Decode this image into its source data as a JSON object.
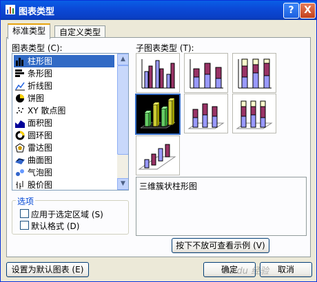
{
  "window": {
    "title": "图表类型"
  },
  "title_buttons": {
    "help": "?",
    "close": "X"
  },
  "tabs": [
    "标准类型",
    "自定义类型"
  ],
  "chart_type_label": "图表类型 (C):",
  "chart_types": [
    "柱形图",
    "条形图",
    "折线图",
    "饼图",
    "XY 散点图",
    "面积图",
    "圆环图",
    "雷达图",
    "曲面图",
    "气泡图",
    "股价图"
  ],
  "selected_chart_type": "柱形图",
  "subtype_label": "子图表类型 (T):",
  "options": {
    "group_label": "选项",
    "apply_to_selection": "应用于选定区域 (S)",
    "default_format": "默认格式 (D)"
  },
  "subtype_description": "三维簇状柱形图",
  "preview_button": "按下不放可查看示例 (V)",
  "set_default_button": "设置为默认图表 (E)",
  "ok_button": "确定",
  "cancel_button": "取消",
  "colors": {
    "accent_tab": "#e6a20c",
    "selection": "#316ac5",
    "bar_purple": "#9999ff",
    "bar_maroon": "#993366",
    "bar_cream": "#ffffcc"
  },
  "watermark": "Baidu 经验"
}
